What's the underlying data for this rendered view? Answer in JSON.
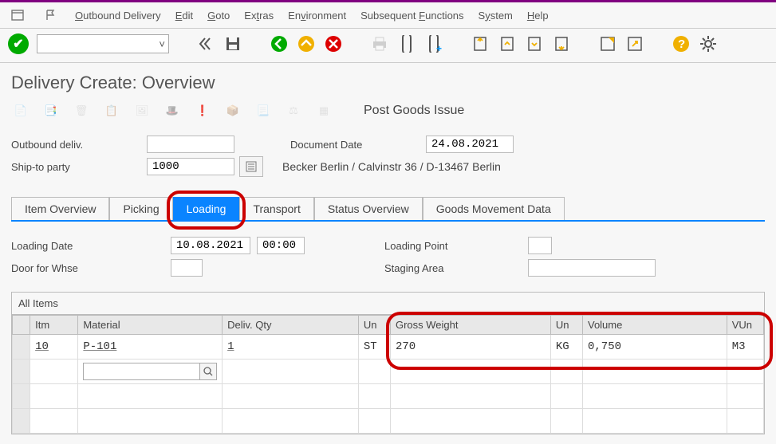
{
  "menu": {
    "items": [
      "Outbound Delivery",
      "Edit",
      "Goto",
      "Extras",
      "Environment",
      "Subsequent Functions",
      "System",
      "Help"
    ],
    "underline_positions": [
      0,
      0,
      0,
      2,
      2,
      11,
      1,
      0
    ]
  },
  "page_title": "Delivery  Create: Overview",
  "post_goods_label": "Post Goods Issue",
  "header_form": {
    "outbound_deliv_label": "Outbound deliv.",
    "outbound_deliv_value": "",
    "ship_to_label": "Ship-to party",
    "ship_to_value": "1000",
    "doc_date_label": "Document Date",
    "doc_date_value": "24.08.2021",
    "ship_to_text": "Becker Berlin / Calvinstr 36 / D-13467 Berlin"
  },
  "tabs": [
    "Item Overview",
    "Picking",
    "Loading",
    "Transport",
    "Status Overview",
    "Goods Movement Data"
  ],
  "active_tab_index": 2,
  "loading_form": {
    "loading_date_label": "Loading Date",
    "loading_date_value": "10.08.2021",
    "loading_time_value": "00:00",
    "door_label": "Door for Whse",
    "door_value": "",
    "loading_point_label": "Loading Point",
    "loading_point_value": "",
    "staging_label": "Staging Area",
    "staging_value": ""
  },
  "grid": {
    "title": "All Items",
    "columns": [
      "Itm",
      "Material",
      "Deliv. Qty",
      "Un",
      "Gross Weight",
      "Un",
      "Volume",
      "VUn"
    ],
    "row": {
      "itm": "10",
      "material": "P-101",
      "qty": "1",
      "un1": "ST",
      "gross": "270",
      "un2": "KG",
      "volume": "0,750",
      "vun": "M3"
    }
  }
}
